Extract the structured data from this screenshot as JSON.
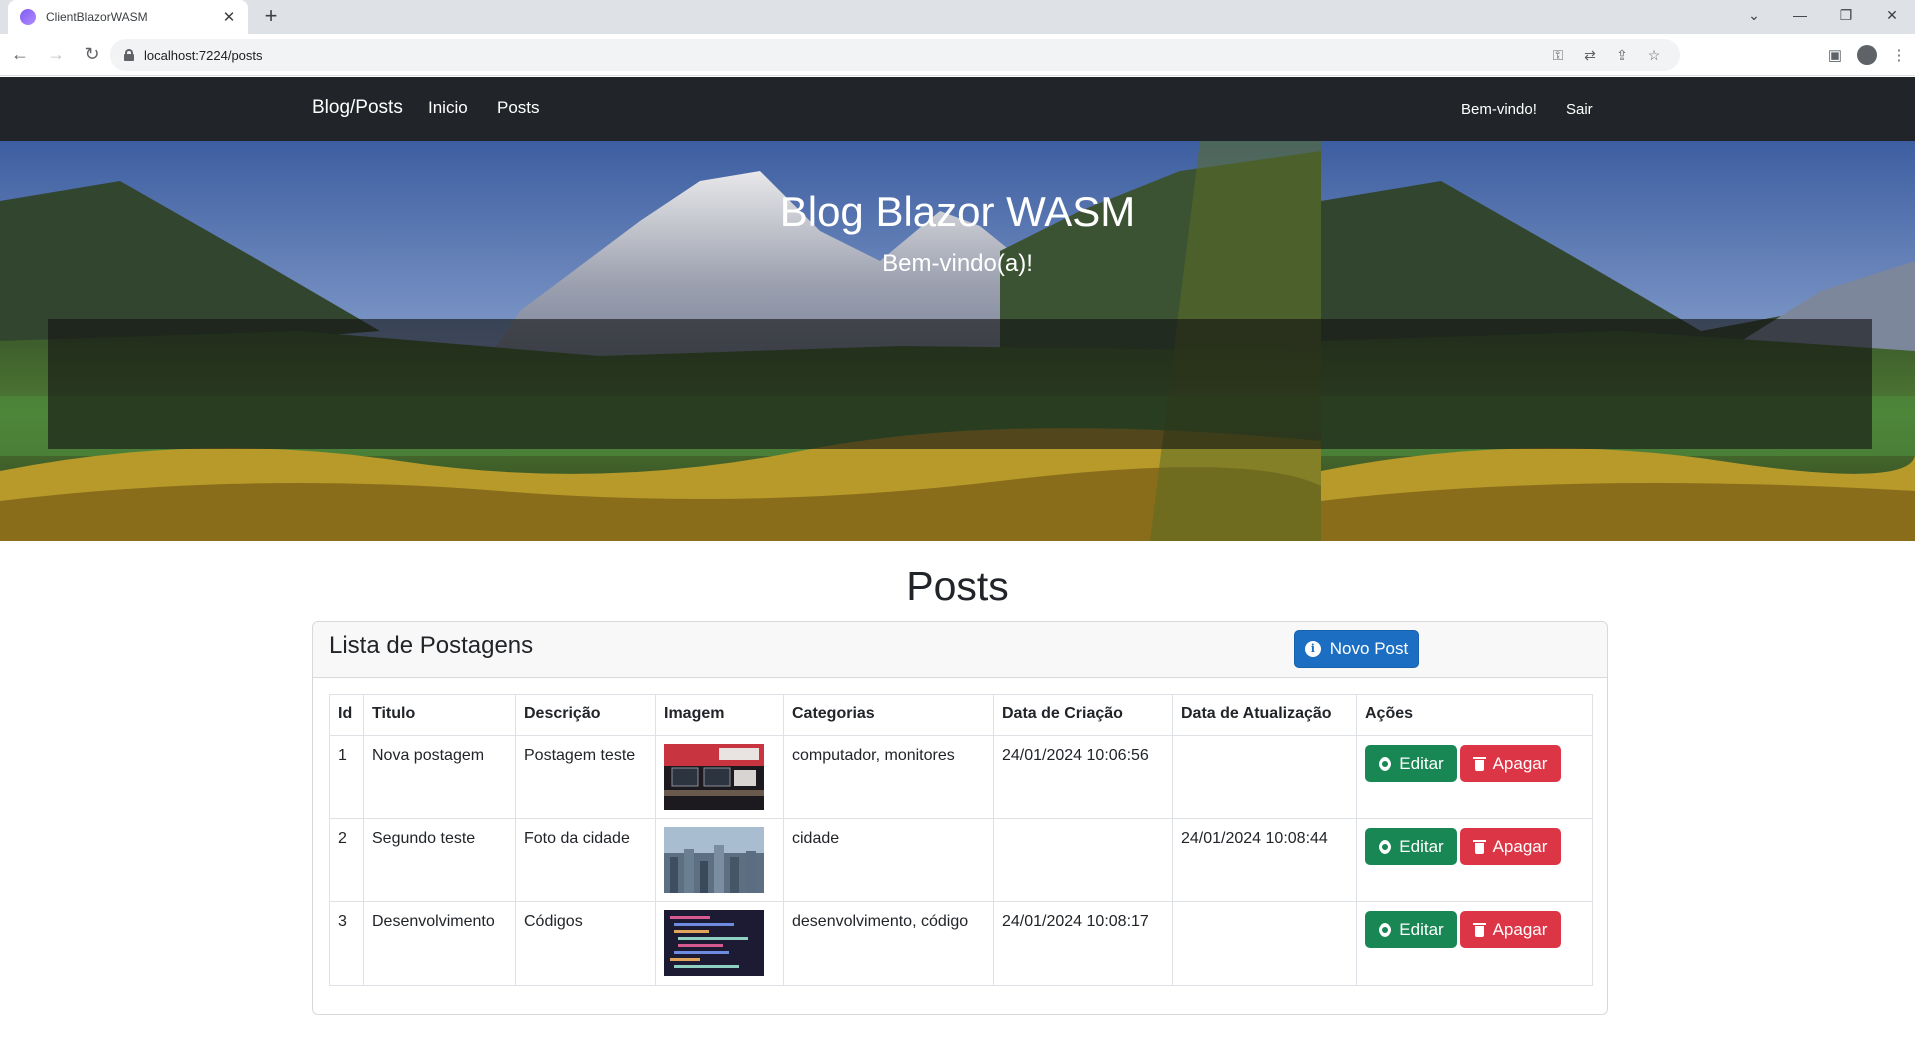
{
  "browser": {
    "tab_title": "ClientBlazorWASM",
    "url": "localhost:7224/posts"
  },
  "navbar": {
    "brand": "Blog/Posts",
    "links": [
      "Inicio",
      "Posts"
    ],
    "welcome": "Bem-vindo!",
    "logout": "Sair",
    "bg_color": "#212529"
  },
  "hero": {
    "title": "Blog Blazor WASM",
    "subtitle": "Bem-vindo(a)!"
  },
  "page": {
    "title": "Posts"
  },
  "card": {
    "title": "Lista de Postagens",
    "new_post_label": "Novo Post",
    "new_post_icon": "info-circle-icon"
  },
  "table": {
    "headers": [
      "Id",
      "Titulo",
      "Descrição",
      "Imagem",
      "Categorias",
      "Data de Criação",
      "Data de Atualização",
      "Ações"
    ],
    "rows": [
      {
        "id": "1",
        "titulo": "Nova postagem",
        "descricao": "Postagem teste",
        "imagem": "desk-computer-monitors-photo",
        "categorias": "computador, monitores",
        "criacao": "24/01/2024 10:06:56",
        "atualizacao": ""
      },
      {
        "id": "2",
        "titulo": "Segundo teste",
        "descricao": "Foto da cidade",
        "imagem": "city-skyline-photo",
        "categorias": "cidade",
        "criacao": "",
        "atualizacao": "24/01/2024 10:08:44"
      },
      {
        "id": "3",
        "titulo": "Desenvolvimento",
        "descricao": "Códigos",
        "imagem": "code-screen-photo",
        "categorias": "desenvolvimento, código",
        "criacao": "24/01/2024 10:08:17",
        "atualizacao": ""
      }
    ],
    "edit_label": "Editar",
    "delete_label": "Apagar",
    "edit_color": "#198754",
    "delete_color": "#dc3545"
  },
  "colors": {
    "primary": "#1b6ec2"
  }
}
